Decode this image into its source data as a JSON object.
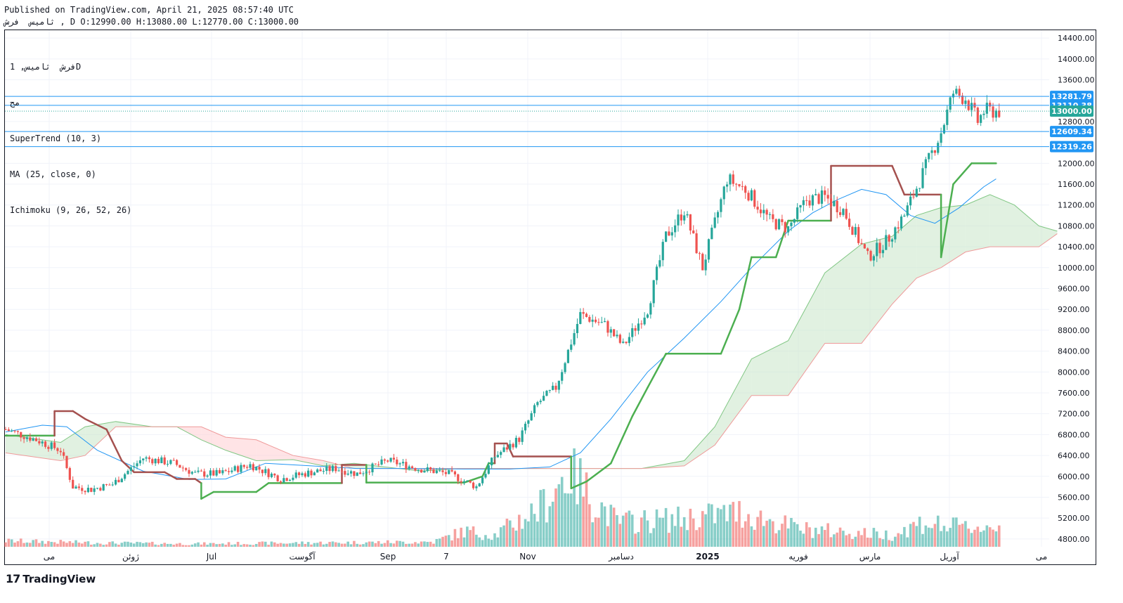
{
  "header": {
    "published": "Published on TradingView.com, April 21, 2025 08:57:40 UTC",
    "ohlc_line": "ثامیس  فرش , D O:12990.00 H:13080.00 L:12770.00 C:13000.00"
  },
  "legend": {
    "symbol": "فرش  ثامیس, 1D",
    "subtitle": "مح",
    "supertrend": "SuperTrend (10, 3)",
    "ma": "MA (25, close, 0)",
    "ichimoku": "Ichimoku (9, 26, 52, 26)"
  },
  "brand": {
    "name": "TradingView",
    "logo": "17"
  },
  "colors": {
    "up": "#26a69a",
    "down": "#ef5350",
    "ma": "#2196f3",
    "supertrend_up": "#4caf50",
    "supertrend_down": "#a5514f",
    "cloud_up": "#c8e6c9",
    "cloud_down": "#ffcdd2",
    "hline": "#2196f3",
    "last_price": "#26a69a"
  },
  "chart_data": {
    "type": "candlestick",
    "y_axis": {
      "range": [
        4650,
        14550
      ],
      "ticks": [
        "14400.00",
        "14000.00",
        "13600.00",
        "12800.00",
        "12000.00",
        "11600.00",
        "11200.00",
        "10800.00",
        "10400.00",
        "10000.00",
        "9600.00",
        "9200.00",
        "8800.00",
        "8400.00",
        "8000.00",
        "7600.00",
        "7200.00",
        "6800.00",
        "6400.00",
        "6000.00",
        "5600.00",
        "5200.00",
        "4800.00"
      ]
    },
    "x_axis": {
      "labels": [
        "می",
        "ژوئن",
        "Jul",
        "آگوست",
        "Sep",
        "7",
        "Nov",
        "دسامبر",
        "2025",
        "فوریه",
        "مارس",
        "آوریل",
        "می"
      ]
    },
    "horizontal_lines": [
      {
        "value": 13281.79,
        "label": "13281.79"
      },
      {
        "value": 13110.38,
        "label": "13110.38"
      },
      {
        "value": 12609.34,
        "label": "12609.34"
      },
      {
        "value": 12319.26,
        "label": "12319.26"
      }
    ],
    "last_price": {
      "value": 13000.0,
      "label": "13000.00"
    },
    "price_path": [
      [
        0,
        6900
      ],
      [
        10,
        6700
      ],
      [
        18,
        6500
      ],
      [
        22,
        5800
      ],
      [
        28,
        5750
      ],
      [
        35,
        5850
      ],
      [
        45,
        6350
      ],
      [
        55,
        6250
      ],
      [
        62,
        6050
      ],
      [
        70,
        6050
      ],
      [
        80,
        6220
      ],
      [
        90,
        5950
      ],
      [
        100,
        6080
      ],
      [
        108,
        6150
      ],
      [
        115,
        6050
      ],
      [
        125,
        6300
      ],
      [
        135,
        6150
      ],
      [
        145,
        6050
      ],
      [
        154,
        5800
      ],
      [
        160,
        6380
      ],
      [
        168,
        6720
      ],
      [
        174,
        7400
      ],
      [
        180,
        7700
      ],
      [
        188,
        9100
      ],
      [
        196,
        8900
      ],
      [
        202,
        8500
      ],
      [
        210,
        9200
      ],
      [
        216,
        10600
      ],
      [
        222,
        11100
      ],
      [
        228,
        10000
      ],
      [
        236,
        11700
      ],
      [
        242,
        11500
      ],
      [
        250,
        10900
      ],
      [
        256,
        10750
      ],
      [
        262,
        11300
      ],
      [
        268,
        11350
      ],
      [
        274,
        11100
      ],
      [
        282,
        10200
      ],
      [
        288,
        10500
      ],
      [
        294,
        11000
      ],
      [
        300,
        11800
      ],
      [
        306,
        12600
      ],
      [
        310,
        13350
      ],
      [
        314,
        13250
      ],
      [
        318,
        12800
      ],
      [
        320,
        13000
      ]
    ],
    "volume_profile": [
      [
        0,
        0.06
      ],
      [
        30,
        0.04
      ],
      [
        60,
        0.03
      ],
      [
        100,
        0.04
      ],
      [
        140,
        0.05
      ],
      [
        150,
        0.16
      ],
      [
        160,
        0.12
      ],
      [
        175,
        0.4
      ],
      [
        185,
        0.8
      ],
      [
        190,
        0.55
      ],
      [
        200,
        0.25
      ],
      [
        220,
        0.28
      ],
      [
        240,
        0.35
      ],
      [
        260,
        0.18
      ],
      [
        275,
        0.15
      ],
      [
        290,
        0.12
      ],
      [
        300,
        0.25
      ],
      [
        310,
        0.2
      ],
      [
        320,
        0.2
      ]
    ],
    "supertrend": [
      [
        0,
        6780,
        "up"
      ],
      [
        16,
        6780,
        "up"
      ],
      [
        16,
        7250,
        "down"
      ],
      [
        22,
        7250,
        "down"
      ],
      [
        26,
        7100,
        "down"
      ],
      [
        33,
        6900,
        "down"
      ],
      [
        38,
        6300,
        "down"
      ],
      [
        42,
        6080,
        "down"
      ],
      [
        52,
        6080,
        "down"
      ],
      [
        56,
        5950,
        "down"
      ],
      [
        62,
        5950,
        "down"
      ],
      [
        64,
        5870,
        "down"
      ],
      [
        64,
        5570,
        "up"
      ],
      [
        68,
        5700,
        "up"
      ],
      [
        82,
        5700,
        "up"
      ],
      [
        86,
        5870,
        "up"
      ],
      [
        110,
        5870,
        "up"
      ],
      [
        110,
        6220,
        "down"
      ],
      [
        118,
        6220,
        "down"
      ],
      [
        118,
        5880,
        "up"
      ],
      [
        150,
        5880,
        "up"
      ],
      [
        156,
        6000,
        "up"
      ],
      [
        158,
        6250,
        "up"
      ],
      [
        160,
        6250,
        "up"
      ],
      [
        160,
        6630,
        "down"
      ],
      [
        164,
        6630,
        "down"
      ],
      [
        166,
        6380,
        "down"
      ],
      [
        185,
        6380,
        "down"
      ],
      [
        185,
        5770,
        "up"
      ],
      [
        190,
        5900,
        "up"
      ],
      [
        198,
        6250,
        "up"
      ],
      [
        205,
        7150,
        "up"
      ],
      [
        210,
        7700,
        "up"
      ],
      [
        216,
        8350,
        "up"
      ],
      [
        234,
        8350,
        "up"
      ],
      [
        240,
        9200,
        "up"
      ],
      [
        244,
        10200,
        "up"
      ],
      [
        252,
        10200,
        "up"
      ],
      [
        256,
        10900,
        "up"
      ],
      [
        270,
        10900,
        "up"
      ],
      [
        270,
        11950,
        "down"
      ],
      [
        290,
        11950,
        "down"
      ],
      [
        294,
        11400,
        "down"
      ],
      [
        306,
        11400,
        "down"
      ],
      [
        306,
        10200,
        "up"
      ],
      [
        310,
        11600,
        "up"
      ],
      [
        316,
        12000,
        "up"
      ],
      [
        324,
        12000,
        "up"
      ]
    ],
    "ma": [
      [
        0,
        6850
      ],
      [
        12,
        6980
      ],
      [
        20,
        6950
      ],
      [
        30,
        6500
      ],
      [
        45,
        6100
      ],
      [
        60,
        5940
      ],
      [
        72,
        5950
      ],
      [
        85,
        6250
      ],
      [
        100,
        6200
      ],
      [
        115,
        6150
      ],
      [
        130,
        6150
      ],
      [
        150,
        6140
      ],
      [
        165,
        6140
      ],
      [
        178,
        6180
      ],
      [
        188,
        6450
      ],
      [
        198,
        7100
      ],
      [
        210,
        8000
      ],
      [
        222,
        8650
      ],
      [
        234,
        9350
      ],
      [
        244,
        10000
      ],
      [
        256,
        10700
      ],
      [
        264,
        11050
      ],
      [
        272,
        11300
      ],
      [
        280,
        11500
      ],
      [
        288,
        11400
      ],
      [
        296,
        11000
      ],
      [
        304,
        10850
      ],
      [
        312,
        11150
      ],
      [
        320,
        11550
      ],
      [
        324,
        11700
      ]
    ],
    "cloud": [
      [
        0,
        6800,
        6450
      ],
      [
        18,
        6650,
        6300
      ],
      [
        26,
        6950,
        6400
      ],
      [
        36,
        7050,
        6950
      ],
      [
        48,
        6950,
        6950
      ],
      [
        56,
        6950,
        6950
      ],
      [
        64,
        6700,
        6950
      ],
      [
        72,
        6500,
        6750
      ],
      [
        82,
        6300,
        6700
      ],
      [
        94,
        6320,
        6400
      ],
      [
        104,
        6200,
        6300
      ],
      [
        114,
        6250,
        6150
      ],
      [
        124,
        6180,
        6150
      ],
      [
        136,
        6100,
        6150
      ],
      [
        148,
        6150,
        6150
      ],
      [
        164,
        6150,
        6150
      ],
      [
        180,
        6150,
        6150
      ],
      [
        196,
        6150,
        6150
      ],
      [
        208,
        6150,
        6150
      ],
      [
        222,
        6300,
        6200
      ],
      [
        232,
        6950,
        6600
      ],
      [
        244,
        8250,
        7550
      ],
      [
        256,
        8600,
        7550
      ],
      [
        268,
        9900,
        8550
      ],
      [
        280,
        10450,
        8550
      ],
      [
        290,
        10600,
        9300
      ],
      [
        298,
        11000,
        9800
      ],
      [
        306,
        11150,
        10000
      ],
      [
        314,
        11200,
        10300
      ],
      [
        322,
        11400,
        10400
      ],
      [
        330,
        11200,
        10400
      ],
      [
        338,
        10800,
        10400
      ],
      [
        344,
        10700,
        10650
      ]
    ]
  }
}
